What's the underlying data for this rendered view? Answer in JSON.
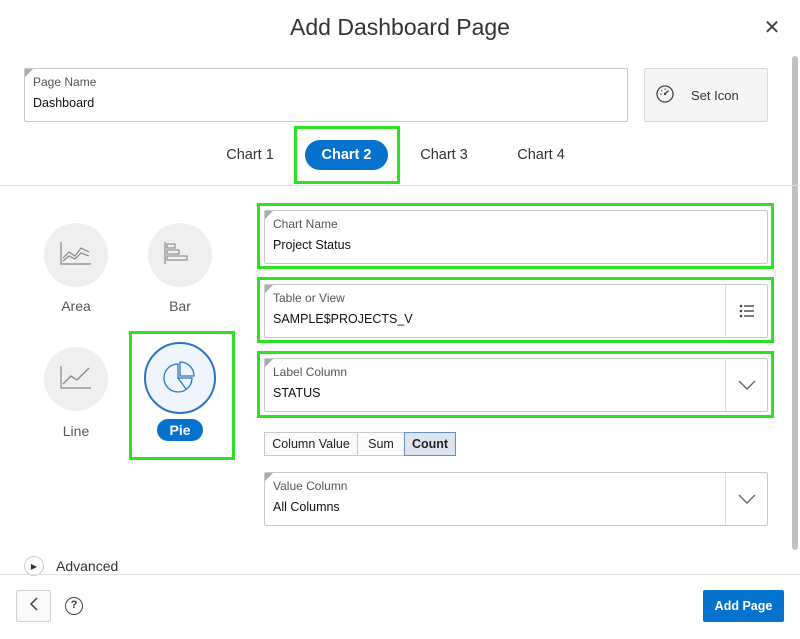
{
  "dialog": {
    "title": "Add Dashboard Page",
    "close_icon": "close-icon"
  },
  "page_name": {
    "label": "Page Name",
    "value": "Dashboard"
  },
  "set_icon": {
    "label": "Set Icon",
    "icon": "speedometer-icon"
  },
  "tabs": [
    {
      "label": "Chart 1",
      "active": false
    },
    {
      "label": "Chart 2",
      "active": true
    },
    {
      "label": "Chart 3",
      "active": false
    },
    {
      "label": "Chart 4",
      "active": false
    }
  ],
  "chart_types": [
    {
      "label": "Area",
      "icon": "area-chart-icon",
      "selected": false
    },
    {
      "label": "Bar",
      "icon": "bar-chart-icon",
      "selected": false
    },
    {
      "label": "Line",
      "icon": "line-chart-icon",
      "selected": false
    },
    {
      "label": "Pie",
      "icon": "pie-chart-icon",
      "selected": true
    }
  ],
  "chart_name": {
    "label": "Chart Name",
    "value": "Project Status"
  },
  "table_or_view": {
    "label": "Table or View",
    "value": "SAMPLE$PROJECTS_V",
    "picker_icon": "list-icon"
  },
  "label_column": {
    "label": "Label Column",
    "value": "STATUS"
  },
  "aggregation": {
    "options": [
      "Column Value",
      "Sum",
      "Count"
    ],
    "selected": "Count"
  },
  "value_column": {
    "label": "Value Column",
    "value": "All Columns"
  },
  "advanced": {
    "label": "Advanced"
  },
  "footer": {
    "help": "?",
    "add_page_label": "Add Page"
  },
  "colors": {
    "accent": "#0572ce",
    "highlight": "#2ee022"
  }
}
